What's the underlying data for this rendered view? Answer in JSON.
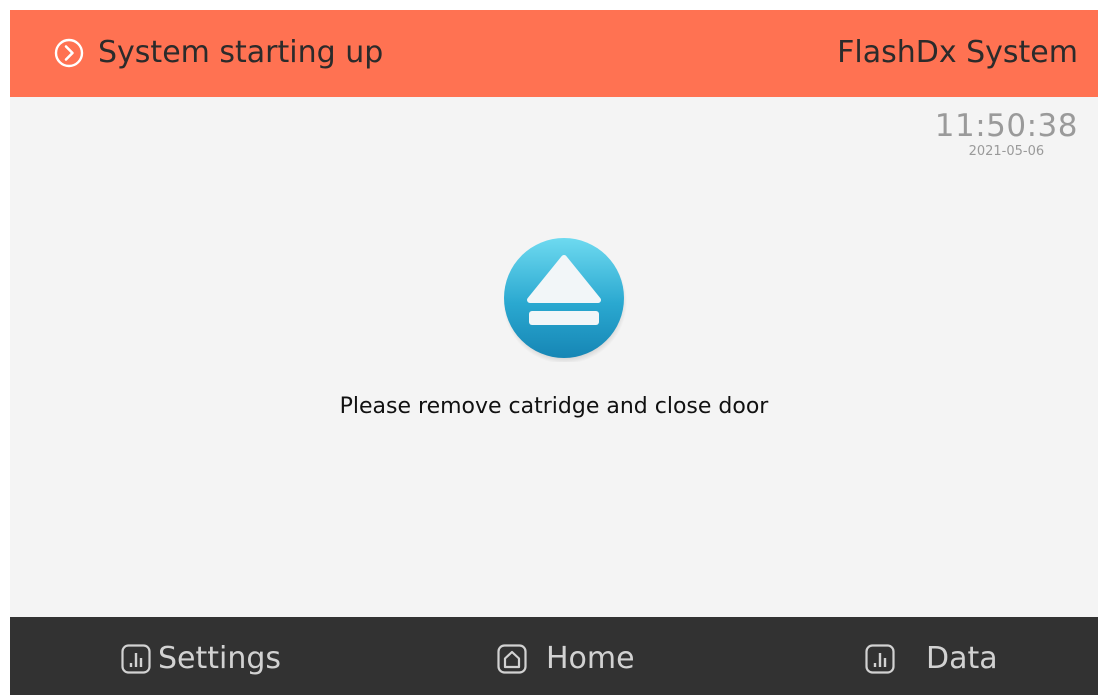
{
  "header": {
    "status_icon": "chevron-right-circle-icon",
    "status_text": "System starting up",
    "system_name": "FlashDx System",
    "background_color": "#ff7252"
  },
  "clock": {
    "time": "11:50:38",
    "date": "2021-05-06"
  },
  "main": {
    "icon": "eject-icon",
    "accent_color": "#29a9cf",
    "message": "Please remove catridge and close door"
  },
  "footer": {
    "background_color": "#323232",
    "nav": [
      {
        "label": "Settings",
        "icon": "bar-chart-icon"
      },
      {
        "label": "Home",
        "icon": "home-icon"
      },
      {
        "label": "Data",
        "icon": "bar-chart-icon"
      }
    ]
  }
}
